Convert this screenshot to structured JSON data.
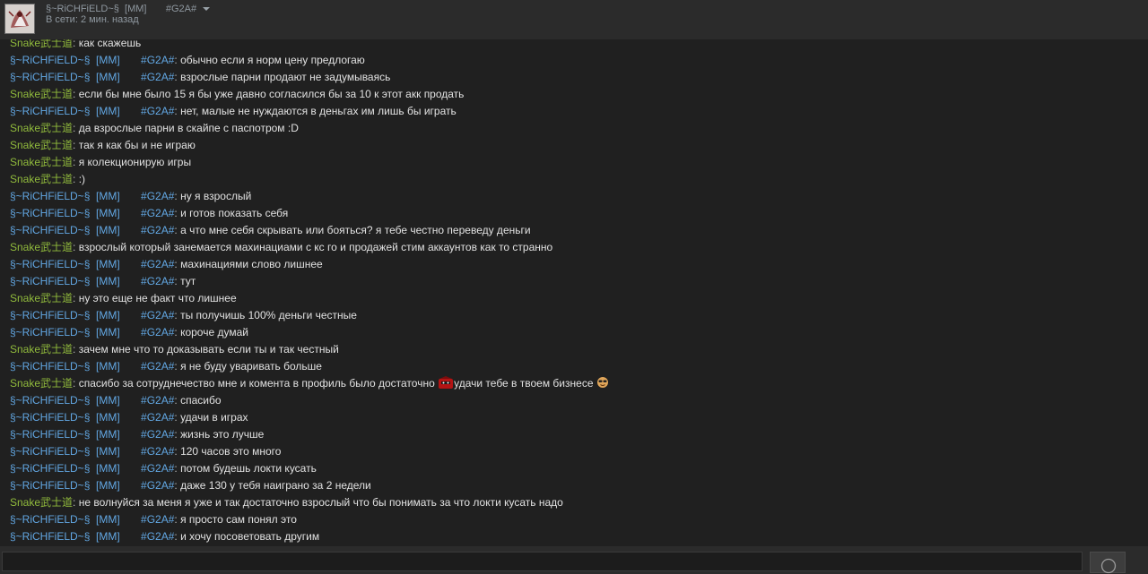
{
  "header": {
    "contact_name": "§~RiCHFiELD~§  [MM]       #G2A#",
    "status": "В сети: 2 мин. назад"
  },
  "input": {
    "placeholder": ""
  },
  "colors": {
    "me": "#62a7e3",
    "friend": "#90ba3c",
    "text": "#e1e1e1"
  },
  "icons": {
    "dropdown": "chevron-down-icon",
    "emoticon": "smiley-icon"
  },
  "messages": [
    {
      "sender": "Snake武士道",
      "who": "friend",
      "text": "как скажешь"
    },
    {
      "sender": "§~RiCHFiELD~§  [MM]       #G2A#",
      "who": "me",
      "text": "обычно если я норм цену предлогаю"
    },
    {
      "sender": "§~RiCHFiELD~§  [MM]       #G2A#",
      "who": "me",
      "text": "взрослые парни продают не задумываясь"
    },
    {
      "sender": "Snake武士道",
      "who": "friend",
      "text": "если бы мне было 15 я бы уже давно согласился бы за 10 к этот акк продать"
    },
    {
      "sender": "§~RiCHFiELD~§  [MM]       #G2A#",
      "who": "me",
      "text": "нет, малые не нуждаются в деньгах им лишь бы играть"
    },
    {
      "sender": "Snake武士道",
      "who": "friend",
      "text": "да взрослые парни в скайпе с паспотром :D"
    },
    {
      "sender": "Snake武士道",
      "who": "friend",
      "text": "так я как бы и не играю"
    },
    {
      "sender": "Snake武士道",
      "who": "friend",
      "text": "я колекционирую игры"
    },
    {
      "sender": "Snake武士道",
      "who": "friend",
      "text": ":)"
    },
    {
      "sender": "§~RiCHFiELD~§  [MM]       #G2A#",
      "who": "me",
      "text": "ну я взрослый"
    },
    {
      "sender": "§~RiCHFiELD~§  [MM]       #G2A#",
      "who": "me",
      "text": "и готов показать себя"
    },
    {
      "sender": "§~RiCHFiELD~§  [MM]       #G2A#",
      "who": "me",
      "text": "а что мне себя скрывать или бояться? я тебе честно переведу деньги"
    },
    {
      "sender": "Snake武士道",
      "who": "friend",
      "text": "взрослый который занемается махинациами с кс го и продажей стим аккаунтов как то странно"
    },
    {
      "sender": "§~RiCHFiELD~§  [MM]       #G2A#",
      "who": "me",
      "text": "махинациями слово лишнее"
    },
    {
      "sender": "§~RiCHFiELD~§  [MM]       #G2A#",
      "who": "me",
      "text": "тут"
    },
    {
      "sender": "Snake武士道",
      "who": "friend",
      "text": "ну это еще не факт что лишнее"
    },
    {
      "sender": "§~RiCHFiELD~§  [MM]       #G2A#",
      "who": "me",
      "text": "ты получишь 100% деньги честные"
    },
    {
      "sender": "§~RiCHFiELD~§  [MM]       #G2A#",
      "who": "me",
      "text": "короче думай"
    },
    {
      "sender": "Snake武士道",
      "who": "friend",
      "text": "зачем мне что то доказывать если ты и так честный"
    },
    {
      "sender": "§~RiCHFiELD~§  [MM]       #G2A#",
      "who": "me",
      "text": "я не буду уваривать больше"
    },
    {
      "sender": "Snake武士道",
      "who": "friend",
      "text": "спасибо за сотруднечество мне и комента в профиль было достаточно",
      "emote1": "red-mask-emoticon-icon",
      "text2": "удачи тебе в твоем бизнесе",
      "emote2": "sunglasses-emoticon-icon"
    },
    {
      "sender": "§~RiCHFiELD~§  [MM]       #G2A#",
      "who": "me",
      "text": "спасибо"
    },
    {
      "sender": "§~RiCHFiELD~§  [MM]       #G2A#",
      "who": "me",
      "text": "удачи в играх"
    },
    {
      "sender": "§~RiCHFiELD~§  [MM]       #G2A#",
      "who": "me",
      "text": "жизнь это лучше"
    },
    {
      "sender": "§~RiCHFiELD~§  [MM]       #G2A#",
      "who": "me",
      "text": "120 часов это много"
    },
    {
      "sender": "§~RiCHFiELD~§  [MM]       #G2A#",
      "who": "me",
      "text": "потом будешь локти кусать"
    },
    {
      "sender": "§~RiCHFiELD~§  [MM]       #G2A#",
      "who": "me",
      "text": "даже 130 у тебя наиграно за 2 недели"
    },
    {
      "sender": "Snake武士道",
      "who": "friend",
      "text": "не волнуйся за меня я уже и так достаточно взрослый что бы понимать за что локти кусать надо"
    },
    {
      "sender": "§~RiCHFiELD~§  [MM]       #G2A#",
      "who": "me",
      "text": "я просто сам понял это"
    },
    {
      "sender": "§~RiCHFiELD~§  [MM]       #G2A#",
      "who": "me",
      "text": "и хочу посоветовать другим"
    }
  ]
}
